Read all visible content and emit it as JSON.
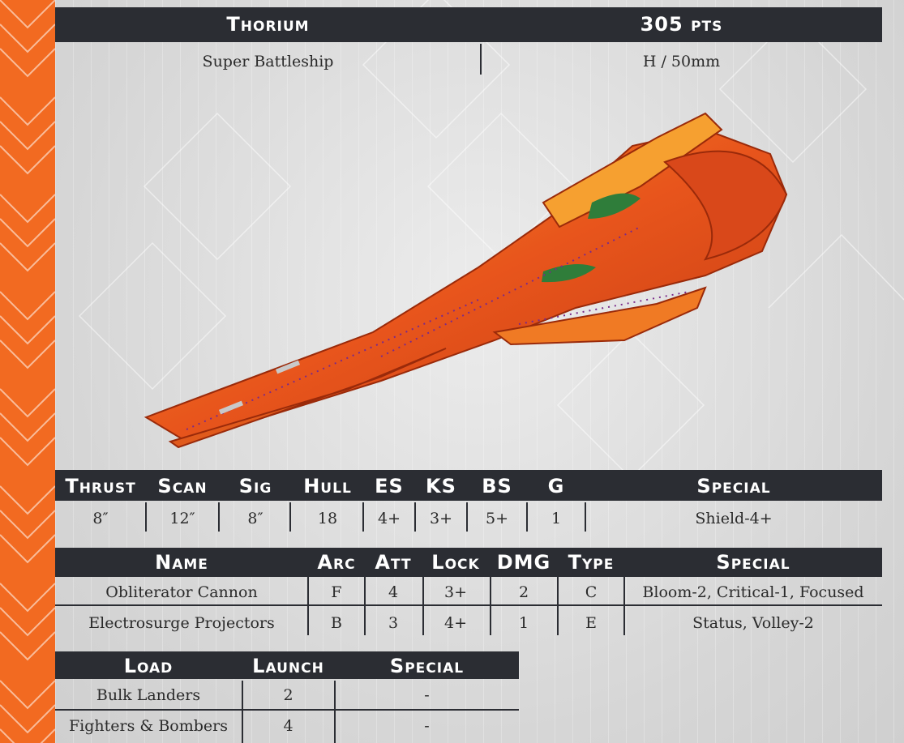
{
  "ship": {
    "name": "Thorium",
    "points": "305 pts",
    "class": "Super Battleship",
    "size": "H / 50mm"
  },
  "stats": {
    "headers": [
      "Thrust",
      "Scan",
      "Sig",
      "Hull",
      "ES",
      "KS",
      "BS",
      "G",
      "Special"
    ],
    "values": [
      "8″",
      "12″",
      "8″",
      "18",
      "4+",
      "3+",
      "5+",
      "1",
      "Shield-4+"
    ]
  },
  "weapons": {
    "headers": [
      "Name",
      "Arc",
      "Att",
      "Lock",
      "DMG",
      "Type",
      "Special"
    ],
    "rows": [
      [
        "Obliterator Cannon",
        "F",
        "4",
        "3+",
        "2",
        "C",
        "Bloom-2, Critical-1, Focused"
      ],
      [
        "Electrosurge Projectors",
        "B",
        "3",
        "4+",
        "1",
        "E",
        "Status, Volley-2"
      ]
    ]
  },
  "launch": {
    "headers": [
      "Load",
      "Launch",
      "Special"
    ],
    "rows": [
      [
        "Bulk Landers",
        "2",
        "-"
      ],
      [
        "Fighters & Bombers",
        "4",
        "-"
      ]
    ]
  },
  "colors": {
    "accent": "#f26a21",
    "header_bg": "#2b2d33",
    "ship": "#e8551c"
  }
}
